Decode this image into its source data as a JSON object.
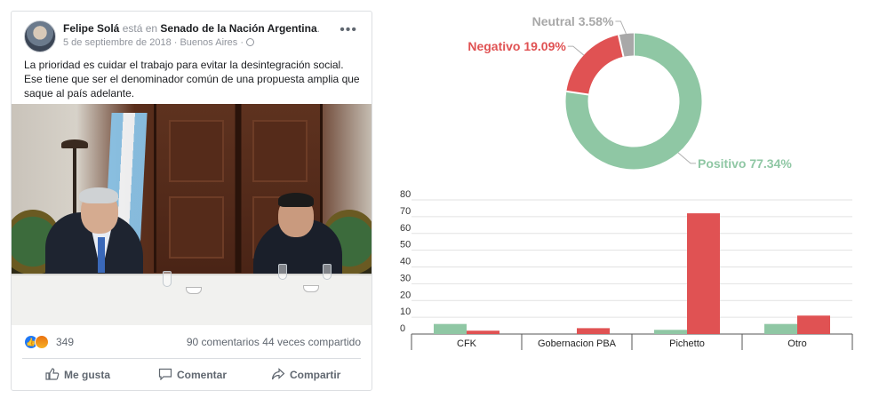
{
  "post": {
    "author": "Felipe Solá",
    "connector": " está en ",
    "place": "Senado de la Nación Argentina",
    "place_suffix": ".",
    "date": "5 de septiembre de 2018 · Buenos Aires ·",
    "more_icon": "•••",
    "text": "La prioridad es cuidar el trabajo para evitar la desintegración social. Ese tiene que ser el denominador común de una propuesta amplia que saque al país adelante.",
    "reactions_count": "349",
    "comments": "90 comentarios",
    "shares": "44 veces compartido",
    "actions": {
      "like": "Me gusta",
      "comment": "Comentar",
      "share": "Compartir"
    }
  },
  "colors": {
    "positive": "#8fc7a4",
    "negative": "#e05253",
    "neutral": "#a8a8a8",
    "fb_blue": "#2078f4"
  },
  "chart_data": [
    {
      "type": "pie",
      "style": "donut",
      "slices": [
        {
          "label": "Positivo",
          "value": 77.34,
          "text": "Positivo 77.34%",
          "color": "#8fc7a4"
        },
        {
          "label": "Negativo",
          "value": 19.09,
          "text": "Negativo 19.09%",
          "color": "#e05253"
        },
        {
          "label": "Neutral",
          "value": 3.58,
          "text": "Neutral 3.58%",
          "color": "#a8a8a8"
        }
      ]
    },
    {
      "type": "bar",
      "categories": [
        "CFK",
        "Gobernacion PBA",
        "Pichetto",
        "Otro"
      ],
      "series": [
        {
          "color": "#8fc7a4",
          "values": [
            6,
            0,
            2.5,
            6
          ]
        },
        {
          "color": "#e05253",
          "values": [
            2,
            3.5,
            72,
            11
          ]
        }
      ],
      "yticks": [
        "80",
        "70",
        "60",
        "50",
        "40",
        "30",
        "20",
        "10",
        "0"
      ],
      "ylim": [
        0,
        80
      ],
      "grid": true
    }
  ]
}
